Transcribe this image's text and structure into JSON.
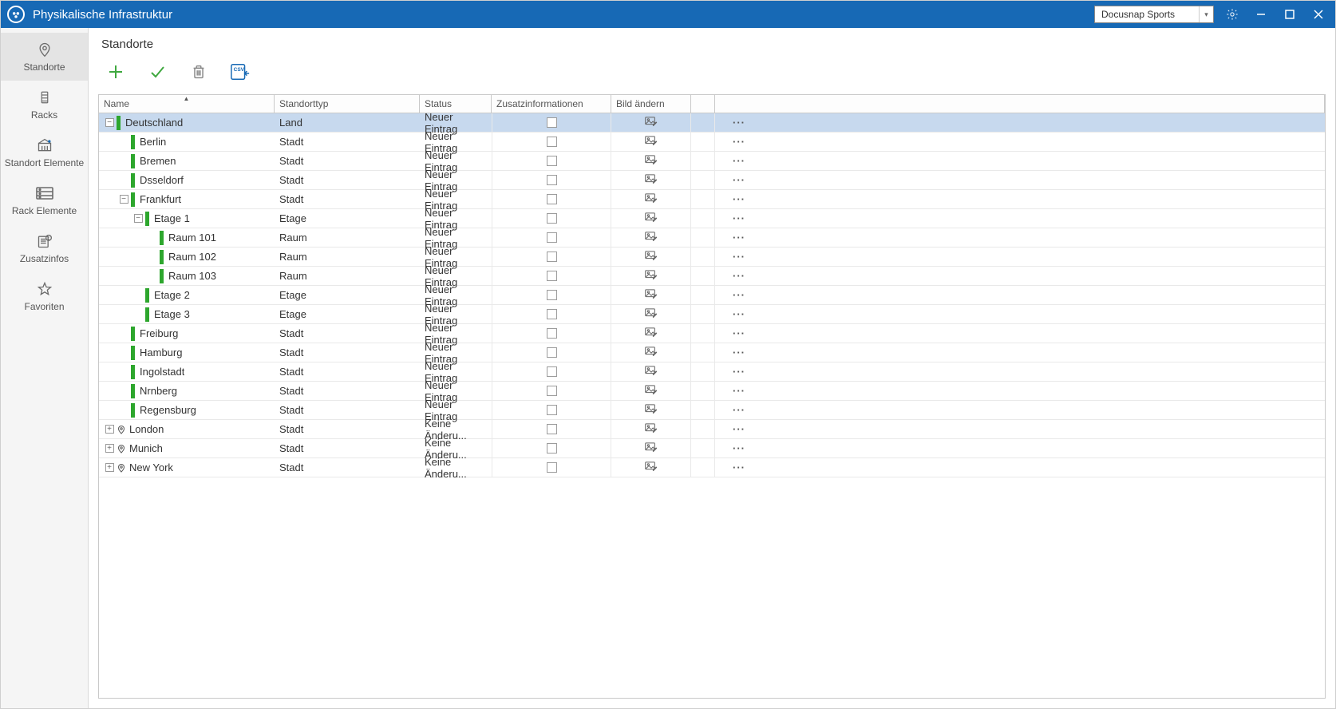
{
  "titlebar": {
    "app_title": "Physikalische Infrastruktur",
    "dropdown_value": "Docusnap Sports"
  },
  "sidebar": {
    "items": [
      {
        "label": "Standorte",
        "icon": "pin",
        "active": true
      },
      {
        "label": "Racks",
        "icon": "rack",
        "active": false
      },
      {
        "label": "Standort Elemente",
        "icon": "building",
        "active": false
      },
      {
        "label": "Rack Elemente",
        "icon": "rack-wide",
        "active": false
      },
      {
        "label": "Zusatzinfos",
        "icon": "info",
        "active": false
      },
      {
        "label": "Favoriten",
        "icon": "star",
        "active": false
      }
    ]
  },
  "main": {
    "title": "Standorte"
  },
  "grid": {
    "columns": {
      "name": "Name",
      "type": "Standorttyp",
      "status": "Status",
      "extra": "Zusatzinformationen",
      "image": "Bild ändern"
    },
    "more_symbol": "···",
    "rows": [
      {
        "expander": "-",
        "indent": 0,
        "green": true,
        "loc": false,
        "name": "Deutschland",
        "type": "Land",
        "status": "Neuer Eintrag",
        "selected": true
      },
      {
        "expander": "",
        "indent": 1,
        "green": true,
        "loc": false,
        "name": "Berlin",
        "type": "Stadt",
        "status": "Neuer Eintrag",
        "selected": false
      },
      {
        "expander": "",
        "indent": 1,
        "green": true,
        "loc": false,
        "name": "Bremen",
        "type": "Stadt",
        "status": "Neuer Eintrag",
        "selected": false
      },
      {
        "expander": "",
        "indent": 1,
        "green": true,
        "loc": false,
        "name": "Dsseldorf",
        "type": "Stadt",
        "status": "Neuer Eintrag",
        "selected": false
      },
      {
        "expander": "-",
        "indent": 1,
        "green": true,
        "loc": false,
        "name": "Frankfurt",
        "type": "Stadt",
        "status": "Neuer Eintrag",
        "selected": false
      },
      {
        "expander": "-",
        "indent": 2,
        "green": true,
        "loc": false,
        "name": "Etage 1",
        "type": "Etage",
        "status": "Neuer Eintrag",
        "selected": false
      },
      {
        "expander": "",
        "indent": 3,
        "green": true,
        "loc": false,
        "name": "Raum 101",
        "type": "Raum",
        "status": "Neuer Eintrag",
        "selected": false
      },
      {
        "expander": "",
        "indent": 3,
        "green": true,
        "loc": false,
        "name": "Raum 102",
        "type": "Raum",
        "status": "Neuer Eintrag",
        "selected": false
      },
      {
        "expander": "",
        "indent": 3,
        "green": true,
        "loc": false,
        "name": "Raum 103",
        "type": "Raum",
        "status": "Neuer Eintrag",
        "selected": false
      },
      {
        "expander": "",
        "indent": 2,
        "green": true,
        "loc": false,
        "name": "Etage 2",
        "type": "Etage",
        "status": "Neuer Eintrag",
        "selected": false
      },
      {
        "expander": "",
        "indent": 2,
        "green": true,
        "loc": false,
        "name": "Etage 3",
        "type": "Etage",
        "status": "Neuer Eintrag",
        "selected": false
      },
      {
        "expander": "",
        "indent": 1,
        "green": true,
        "loc": false,
        "name": "Freiburg",
        "type": "Stadt",
        "status": "Neuer Eintrag",
        "selected": false
      },
      {
        "expander": "",
        "indent": 1,
        "green": true,
        "loc": false,
        "name": "Hamburg",
        "type": "Stadt",
        "status": "Neuer Eintrag",
        "selected": false
      },
      {
        "expander": "",
        "indent": 1,
        "green": true,
        "loc": false,
        "name": "Ingolstadt",
        "type": "Stadt",
        "status": "Neuer Eintrag",
        "selected": false
      },
      {
        "expander": "",
        "indent": 1,
        "green": true,
        "loc": false,
        "name": "Nrnberg",
        "type": "Stadt",
        "status": "Neuer Eintrag",
        "selected": false
      },
      {
        "expander": "",
        "indent": 1,
        "green": true,
        "loc": false,
        "name": "Regensburg",
        "type": "Stadt",
        "status": "Neuer Eintrag",
        "selected": false
      },
      {
        "expander": "+",
        "indent": 0,
        "green": false,
        "loc": true,
        "name": "London",
        "type": "Stadt",
        "status": "Keine Änderu...",
        "selected": false
      },
      {
        "expander": "+",
        "indent": 0,
        "green": false,
        "loc": true,
        "name": "Munich",
        "type": "Stadt",
        "status": "Keine Änderu...",
        "selected": false
      },
      {
        "expander": "+",
        "indent": 0,
        "green": false,
        "loc": true,
        "name": "New York",
        "type": "Stadt",
        "status": "Keine Änderu...",
        "selected": false
      }
    ]
  }
}
